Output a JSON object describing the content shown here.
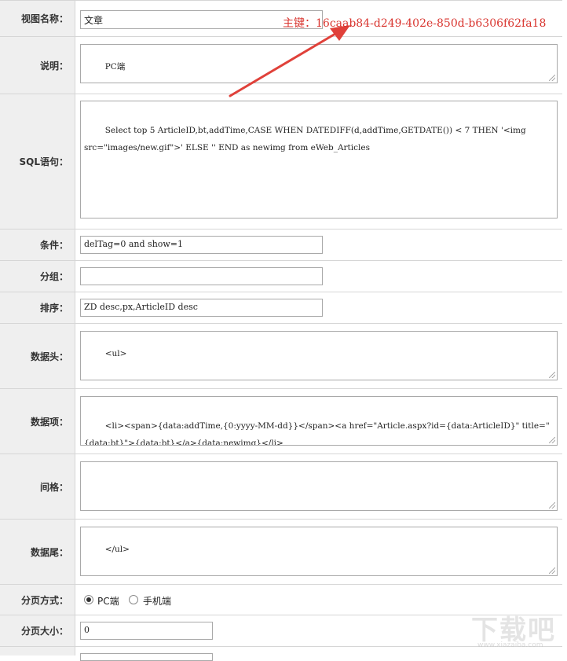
{
  "annotation": {
    "text": "主键：16caab84-d249-402e-850d-b6306f62fa18",
    "color": "#d9352f"
  },
  "form": {
    "view_name": {
      "label": "视图名称：",
      "value": "文章"
    },
    "description": {
      "label": "说明：",
      "value": "PC端"
    },
    "sql": {
      "label": "SQL语句：",
      "value": "Select top 5 ArticleID,bt,addTime,CASE WHEN DATEDIFF(d,addTime,GETDATE()) < 7 THEN '<img src=\"images/new.gif\">' ELSE '' END as newimg from eWeb_Articles"
    },
    "condition": {
      "label": "条件：",
      "value": "delTag=0 and show=1"
    },
    "grouping": {
      "label": "分组：",
      "value": ""
    },
    "sorting": {
      "label": "排序：",
      "value": "ZD desc,px,ArticleID desc"
    },
    "data_head": {
      "label": "数据头：",
      "value": "<ul>"
    },
    "data_item": {
      "label": "数据项：",
      "value": "<li><span>{data:addTime,{0:yyyy-MM-dd}}</span><a href=\"Article.aspx?id={data:ArticleID}\" title=\"{data:bt}\">{data:bt}</a>{data:newimg}</li>"
    },
    "separator": {
      "label": "间格：",
      "value": ""
    },
    "data_tail": {
      "label": "数据尾：",
      "value": "</ul>"
    },
    "paging_mode": {
      "label": "分页方式：",
      "options": [
        "PC端",
        "手机端"
      ],
      "selected": "PC端"
    },
    "page_size": {
      "label": "分页大小：",
      "value": "0"
    }
  },
  "watermark": {
    "text": "下载吧",
    "url": "www.xiazaiba.com"
  }
}
